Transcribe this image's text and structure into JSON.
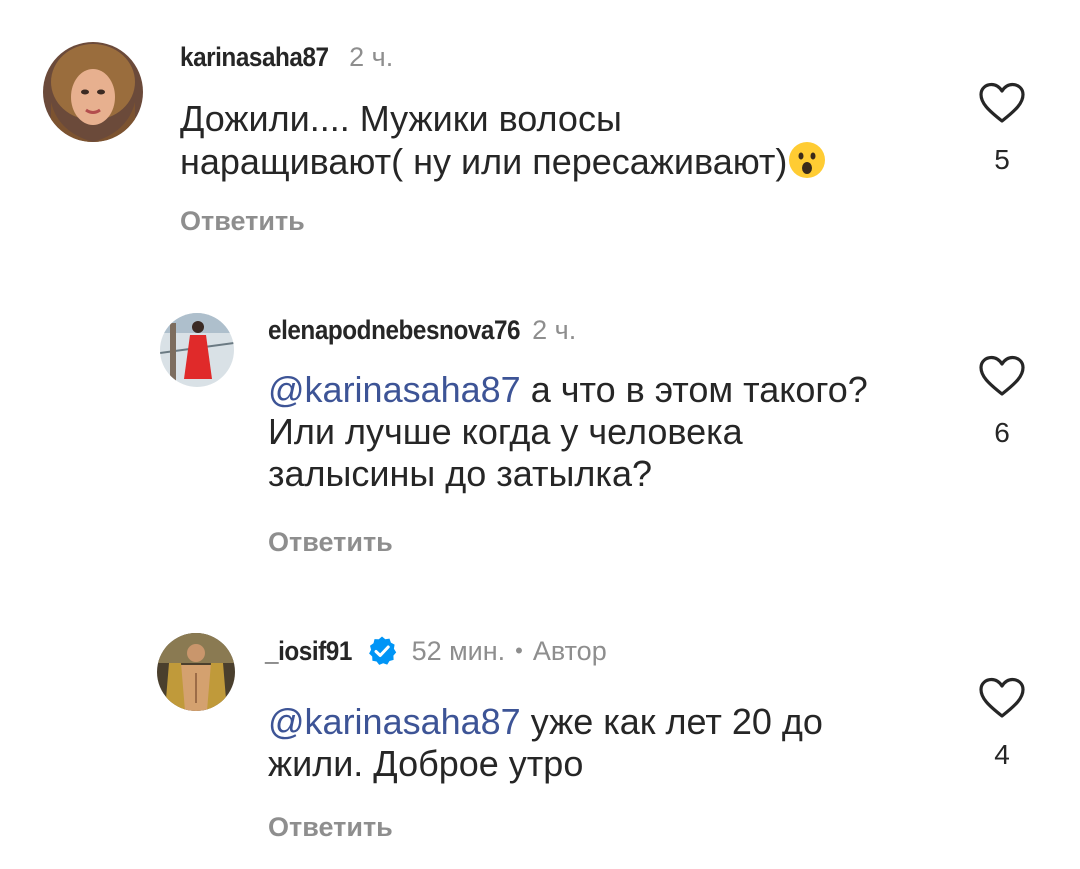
{
  "comments": [
    {
      "username": "karinasaha87",
      "time": "2 ч.",
      "text_line1": "Дожили.... Мужики волосы",
      "text_line2": "наращивают( ну или пересаживают)",
      "emoji": "astonished-face",
      "reply_label": "Ответить",
      "likes": "5",
      "heart_icon": "heart-outline-icon"
    },
    {
      "username": "elenapodnebesnova76",
      "time": "2 ч.",
      "mention": "@karinasaha87",
      "text_line1_rest": " а что в этом такого?",
      "text_line2": "Или лучше когда у человека",
      "text_line3": "залысины до затылка?",
      "reply_label": "Ответить",
      "likes": "6",
      "heart_icon": "heart-outline-icon"
    },
    {
      "username": "_iosif91",
      "verified": true,
      "time": "52 мин.",
      "separator": "•",
      "author_label": "Автор",
      "mention": "@karinasaha87",
      "text_line1_rest": " уже как лет 20 до",
      "text_line2": "жили. Доброе утро",
      "reply_label": "Ответить",
      "likes": "4",
      "heart_icon": "heart-outline-icon"
    }
  ],
  "colors": {
    "text": "#262626",
    "secondary": "#8e8e8e",
    "mention": "#3d5496",
    "verified": "#0095f6"
  }
}
